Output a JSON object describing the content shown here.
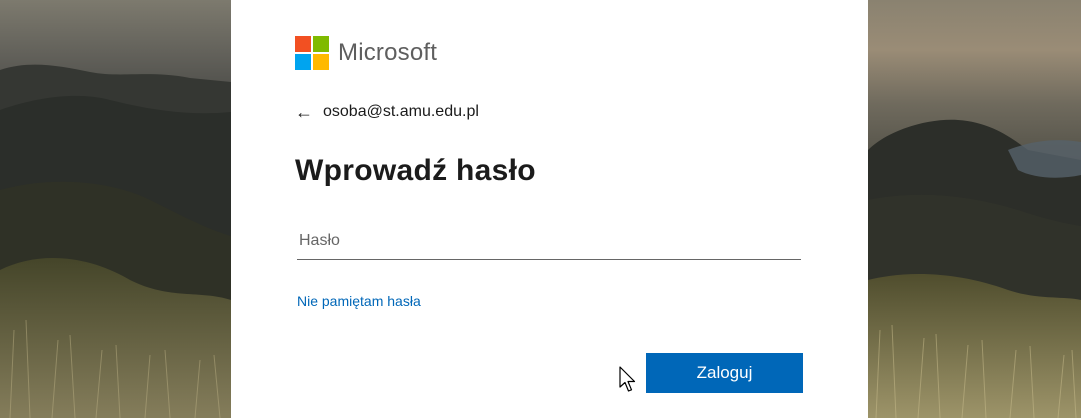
{
  "brand": {
    "name": "Microsoft",
    "logo_colors": [
      "#f25022",
      "#7fba00",
      "#00a4ef",
      "#ffb900"
    ]
  },
  "identity": {
    "back_icon": "←",
    "email": "osoba@st.amu.edu.pl"
  },
  "page": {
    "title": "Wprowadź hasło"
  },
  "password_field": {
    "placeholder": "Hasło",
    "value": ""
  },
  "links": {
    "forgot_password": "Nie pamiętam hasła"
  },
  "actions": {
    "sign_in": "Zaloguj"
  },
  "colors": {
    "accent": "#0067b8",
    "text": "#1b1b1b"
  }
}
